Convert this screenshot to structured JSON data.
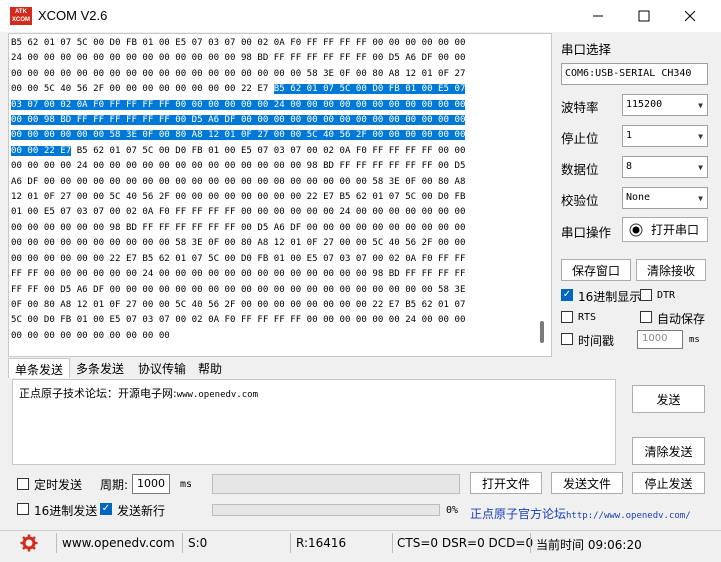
{
  "window": {
    "logo_text": "ATK\nXCOM",
    "title": "XCOM V2.6",
    "minimize": "—",
    "maximize": "☐",
    "close": "✕"
  },
  "receive": {
    "lines": [
      {
        "plain": "B5 62 01 07 5C 00 D0 FB 01 00 E5 07 03 07 00 02 0A F0 FF FF FF FF 00 00 00 00 00 00",
        "sel": "",
        "tail": ""
      },
      {
        "plain": "24 00 00 00 00 00 00 00 00 00 00 00 00 00 98 BD FF FF FF FF FF FF 00 D5 A6 DF 00 00",
        "sel": "",
        "tail": ""
      },
      {
        "plain": "00 00 00 00 00 00 00 00 00 00 00 00 00 00 00 00 00 00 58 3E 0F 00 80 A8 12 01 0F 27",
        "sel": "",
        "tail": ""
      },
      {
        "plain": "00 00 5C 40 56 2F 00 00 00 00 00 00 00 00 22 E7 ",
        "sel": "B5 62 01 07 5C 00 D0 FB 01 00 E5 07",
        "tail": ""
      },
      {
        "plain": "",
        "sel": "03 07 00 02 0A F0 FF FF FF FF 00 00 00 00 00 00 24 00 00 00 00 00 00 00 00 00 00 00",
        "tail": ""
      },
      {
        "plain": "",
        "sel": "00 00 98 BD FF FF FF FF FF FF 00 D5 A6 DF 00 00 00 00 00 00 00 00 00 00 00 00 00 00",
        "tail": ""
      },
      {
        "plain": "",
        "sel": "00 00 00 00 00 00 58 3E 0F 00 80 A8 12 01 0F 27 00 00 5C 40 56 2F 00 00 00 00 00 00",
        "tail": ""
      },
      {
        "plain": "",
        "sel": "00 00 22 E7",
        "tail": " B5 62 01 07 5C 00 D0 FB 01 00 E5 07 03 07 00 02 0A F0 FF FF FF FF 00 00"
      },
      {
        "plain": "00 00 00 00 24 00 00 00 00 00 00 00 00 00 00 00 00 00 98 BD FF FF FF FF FF FF 00 D5",
        "sel": "",
        "tail": ""
      },
      {
        "plain": "A6 DF 00 00 00 00 00 00 00 00 00 00 00 00 00 00 00 00 00 00 00 00 58 3E 0F 00 80 A8",
        "sel": "",
        "tail": ""
      },
      {
        "plain": "12 01 0F 27 00 00 5C 40 56 2F 00 00 00 00 00 00 00 00 22 E7 B5 62 01 07 5C 00 D0 FB",
        "sel": "",
        "tail": ""
      },
      {
        "plain": "01 00 E5 07 03 07 00 02 0A F0 FF FF FF FF 00 00 00 00 00 00 24 00 00 00 00 00 00 00",
        "sel": "",
        "tail": ""
      },
      {
        "plain": "00 00 00 00 00 00 98 BD FF FF FF FF FF FF 00 D5 A6 DF 00 00 00 00 00 00 00 00 00 00",
        "sel": "",
        "tail": ""
      },
      {
        "plain": "00 00 00 00 00 00 00 00 00 00 58 3E 0F 00 80 A8 12 01 0F 27 00 00 5C 40 56 2F 00 00",
        "sel": "",
        "tail": ""
      },
      {
        "plain": "00 00 00 00 00 00 22 E7 B5 62 01 07 5C 00 D0 FB 01 00 E5 07 03 07 00 02 0A F0 FF FF",
        "sel": "",
        "tail": ""
      },
      {
        "plain": "FF FF 00 00 00 00 00 00 24 00 00 00 00 00 00 00 00 00 00 00 00 00 98 BD FF FF FF FF",
        "sel": "",
        "tail": ""
      },
      {
        "plain": "FF FF 00 D5 A6 DF 00 00 00 00 00 00 00 00 00 00 00 00 00 00 00 00 00 00 00 00 58 3E",
        "sel": "",
        "tail": ""
      },
      {
        "plain": "0F 00 80 A8 12 01 0F 27 00 00 5C 40 56 2F 00 00 00 00 00 00 00 00 22 E7 B5 62 01 07",
        "sel": "",
        "tail": ""
      },
      {
        "plain": "5C 00 D0 FB 01 00 E5 07 03 07 00 02 0A F0 FF FF FF FF 00 00 00 00 00 00 24 00 00 00",
        "sel": "",
        "tail": ""
      },
      {
        "plain": "00 00 00 00 00 00 00 00 00 00",
        "sel": "",
        "tail": ""
      }
    ]
  },
  "settings": {
    "port_label": "串口选择",
    "port_value": "COM6:USB-SERIAL CH340",
    "baud_label": "波特率",
    "baud_value": "115200",
    "stopbits_label": "停止位",
    "stopbits_value": "1",
    "databits_label": "数据位",
    "databits_value": "8",
    "parity_label": "校验位",
    "parity_value": "None",
    "op_label": "串口操作",
    "open_port_button": "打开串口",
    "save_window_button": "保存窗口",
    "clear_receive_button": "清除接收",
    "hex_display_label": "16进制显示",
    "dtr_label": "DTR",
    "rts_label": "RTS",
    "autosave_label": "自动保存",
    "timestamp_label": "时间戳",
    "timestamp_value": "1000",
    "timestamp_unit": "ms"
  },
  "tabs": [
    "单条发送",
    "多条发送",
    "协议传输",
    "帮助"
  ],
  "send": {
    "text_prefix": "正点原子技术论坛：开源电子网:",
    "text_url": "www.openedv.com",
    "send_button": "发送",
    "clear_send_button": "清除发送",
    "timed_send_label": "定时发送",
    "period_label": "周期:",
    "period_value": "1000",
    "period_unit": "ms",
    "hex_send_label": "16进制发送",
    "newline_label": "发送新行",
    "progress_text": "0%",
    "open_file_button": "打开文件",
    "send_file_button": "发送文件",
    "stop_send_button": "停止发送",
    "forum_text": "正点原子官方论坛",
    "forum_url": "http://www.openedv.com/"
  },
  "status": {
    "url": "www.openedv.com",
    "sent": "S:0",
    "received": "R:16416",
    "lines": "CTS=0 DSR=0 DCD=0",
    "time": "当前时间 09:06:20"
  },
  "colors": {
    "selection": "#0078d7",
    "logo": "#d42a1e",
    "checkbox": "#0067c0",
    "forum_link": "#1a3fb5"
  },
  "icons": {
    "settings": "gear-icon",
    "radio": "radio-dot-icon"
  }
}
